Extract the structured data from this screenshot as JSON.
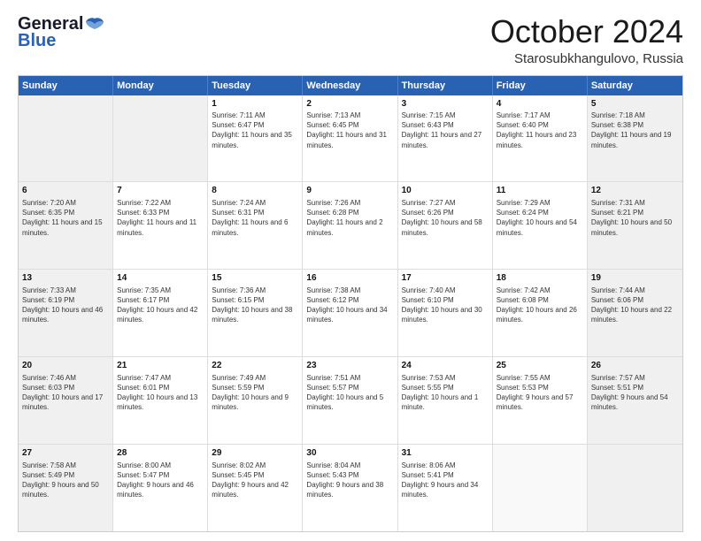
{
  "logo": {
    "line1": "General",
    "line2": "Blue"
  },
  "header": {
    "month": "October 2024",
    "location": "Starosubkhangulovo, Russia"
  },
  "weekdays": [
    "Sunday",
    "Monday",
    "Tuesday",
    "Wednesday",
    "Thursday",
    "Friday",
    "Saturday"
  ],
  "rows": [
    [
      {
        "day": "",
        "sunrise": "",
        "sunset": "",
        "daylight": "",
        "shaded": true
      },
      {
        "day": "",
        "sunrise": "",
        "sunset": "",
        "daylight": "",
        "shaded": true
      },
      {
        "day": "1",
        "sunrise": "Sunrise: 7:11 AM",
        "sunset": "Sunset: 6:47 PM",
        "daylight": "Daylight: 11 hours and 35 minutes.",
        "shaded": false
      },
      {
        "day": "2",
        "sunrise": "Sunrise: 7:13 AM",
        "sunset": "Sunset: 6:45 PM",
        "daylight": "Daylight: 11 hours and 31 minutes.",
        "shaded": false
      },
      {
        "day": "3",
        "sunrise": "Sunrise: 7:15 AM",
        "sunset": "Sunset: 6:43 PM",
        "daylight": "Daylight: 11 hours and 27 minutes.",
        "shaded": false
      },
      {
        "day": "4",
        "sunrise": "Sunrise: 7:17 AM",
        "sunset": "Sunset: 6:40 PM",
        "daylight": "Daylight: 11 hours and 23 minutes.",
        "shaded": false
      },
      {
        "day": "5",
        "sunrise": "Sunrise: 7:18 AM",
        "sunset": "Sunset: 6:38 PM",
        "daylight": "Daylight: 11 hours and 19 minutes.",
        "shaded": true
      }
    ],
    [
      {
        "day": "6",
        "sunrise": "Sunrise: 7:20 AM",
        "sunset": "Sunset: 6:35 PM",
        "daylight": "Daylight: 11 hours and 15 minutes.",
        "shaded": true
      },
      {
        "day": "7",
        "sunrise": "Sunrise: 7:22 AM",
        "sunset": "Sunset: 6:33 PM",
        "daylight": "Daylight: 11 hours and 11 minutes.",
        "shaded": false
      },
      {
        "day": "8",
        "sunrise": "Sunrise: 7:24 AM",
        "sunset": "Sunset: 6:31 PM",
        "daylight": "Daylight: 11 hours and 6 minutes.",
        "shaded": false
      },
      {
        "day": "9",
        "sunrise": "Sunrise: 7:26 AM",
        "sunset": "Sunset: 6:28 PM",
        "daylight": "Daylight: 11 hours and 2 minutes.",
        "shaded": false
      },
      {
        "day": "10",
        "sunrise": "Sunrise: 7:27 AM",
        "sunset": "Sunset: 6:26 PM",
        "daylight": "Daylight: 10 hours and 58 minutes.",
        "shaded": false
      },
      {
        "day": "11",
        "sunrise": "Sunrise: 7:29 AM",
        "sunset": "Sunset: 6:24 PM",
        "daylight": "Daylight: 10 hours and 54 minutes.",
        "shaded": false
      },
      {
        "day": "12",
        "sunrise": "Sunrise: 7:31 AM",
        "sunset": "Sunset: 6:21 PM",
        "daylight": "Daylight: 10 hours and 50 minutes.",
        "shaded": true
      }
    ],
    [
      {
        "day": "13",
        "sunrise": "Sunrise: 7:33 AM",
        "sunset": "Sunset: 6:19 PM",
        "daylight": "Daylight: 10 hours and 46 minutes.",
        "shaded": true
      },
      {
        "day": "14",
        "sunrise": "Sunrise: 7:35 AM",
        "sunset": "Sunset: 6:17 PM",
        "daylight": "Daylight: 10 hours and 42 minutes.",
        "shaded": false
      },
      {
        "day": "15",
        "sunrise": "Sunrise: 7:36 AM",
        "sunset": "Sunset: 6:15 PM",
        "daylight": "Daylight: 10 hours and 38 minutes.",
        "shaded": false
      },
      {
        "day": "16",
        "sunrise": "Sunrise: 7:38 AM",
        "sunset": "Sunset: 6:12 PM",
        "daylight": "Daylight: 10 hours and 34 minutes.",
        "shaded": false
      },
      {
        "day": "17",
        "sunrise": "Sunrise: 7:40 AM",
        "sunset": "Sunset: 6:10 PM",
        "daylight": "Daylight: 10 hours and 30 minutes.",
        "shaded": false
      },
      {
        "day": "18",
        "sunrise": "Sunrise: 7:42 AM",
        "sunset": "Sunset: 6:08 PM",
        "daylight": "Daylight: 10 hours and 26 minutes.",
        "shaded": false
      },
      {
        "day": "19",
        "sunrise": "Sunrise: 7:44 AM",
        "sunset": "Sunset: 6:06 PM",
        "daylight": "Daylight: 10 hours and 22 minutes.",
        "shaded": true
      }
    ],
    [
      {
        "day": "20",
        "sunrise": "Sunrise: 7:46 AM",
        "sunset": "Sunset: 6:03 PM",
        "daylight": "Daylight: 10 hours and 17 minutes.",
        "shaded": true
      },
      {
        "day": "21",
        "sunrise": "Sunrise: 7:47 AM",
        "sunset": "Sunset: 6:01 PM",
        "daylight": "Daylight: 10 hours and 13 minutes.",
        "shaded": false
      },
      {
        "day": "22",
        "sunrise": "Sunrise: 7:49 AM",
        "sunset": "Sunset: 5:59 PM",
        "daylight": "Daylight: 10 hours and 9 minutes.",
        "shaded": false
      },
      {
        "day": "23",
        "sunrise": "Sunrise: 7:51 AM",
        "sunset": "Sunset: 5:57 PM",
        "daylight": "Daylight: 10 hours and 5 minutes.",
        "shaded": false
      },
      {
        "day": "24",
        "sunrise": "Sunrise: 7:53 AM",
        "sunset": "Sunset: 5:55 PM",
        "daylight": "Daylight: 10 hours and 1 minute.",
        "shaded": false
      },
      {
        "day": "25",
        "sunrise": "Sunrise: 7:55 AM",
        "sunset": "Sunset: 5:53 PM",
        "daylight": "Daylight: 9 hours and 57 minutes.",
        "shaded": false
      },
      {
        "day": "26",
        "sunrise": "Sunrise: 7:57 AM",
        "sunset": "Sunset: 5:51 PM",
        "daylight": "Daylight: 9 hours and 54 minutes.",
        "shaded": true
      }
    ],
    [
      {
        "day": "27",
        "sunrise": "Sunrise: 7:58 AM",
        "sunset": "Sunset: 5:49 PM",
        "daylight": "Daylight: 9 hours and 50 minutes.",
        "shaded": true
      },
      {
        "day": "28",
        "sunrise": "Sunrise: 8:00 AM",
        "sunset": "Sunset: 5:47 PM",
        "daylight": "Daylight: 9 hours and 46 minutes.",
        "shaded": false
      },
      {
        "day": "29",
        "sunrise": "Sunrise: 8:02 AM",
        "sunset": "Sunset: 5:45 PM",
        "daylight": "Daylight: 9 hours and 42 minutes.",
        "shaded": false
      },
      {
        "day": "30",
        "sunrise": "Sunrise: 8:04 AM",
        "sunset": "Sunset: 5:43 PM",
        "daylight": "Daylight: 9 hours and 38 minutes.",
        "shaded": false
      },
      {
        "day": "31",
        "sunrise": "Sunrise: 8:06 AM",
        "sunset": "Sunset: 5:41 PM",
        "daylight": "Daylight: 9 hours and 34 minutes.",
        "shaded": false
      },
      {
        "day": "",
        "sunrise": "",
        "sunset": "",
        "daylight": "",
        "shaded": false
      },
      {
        "day": "",
        "sunrise": "",
        "sunset": "",
        "daylight": "",
        "shaded": true
      }
    ]
  ]
}
